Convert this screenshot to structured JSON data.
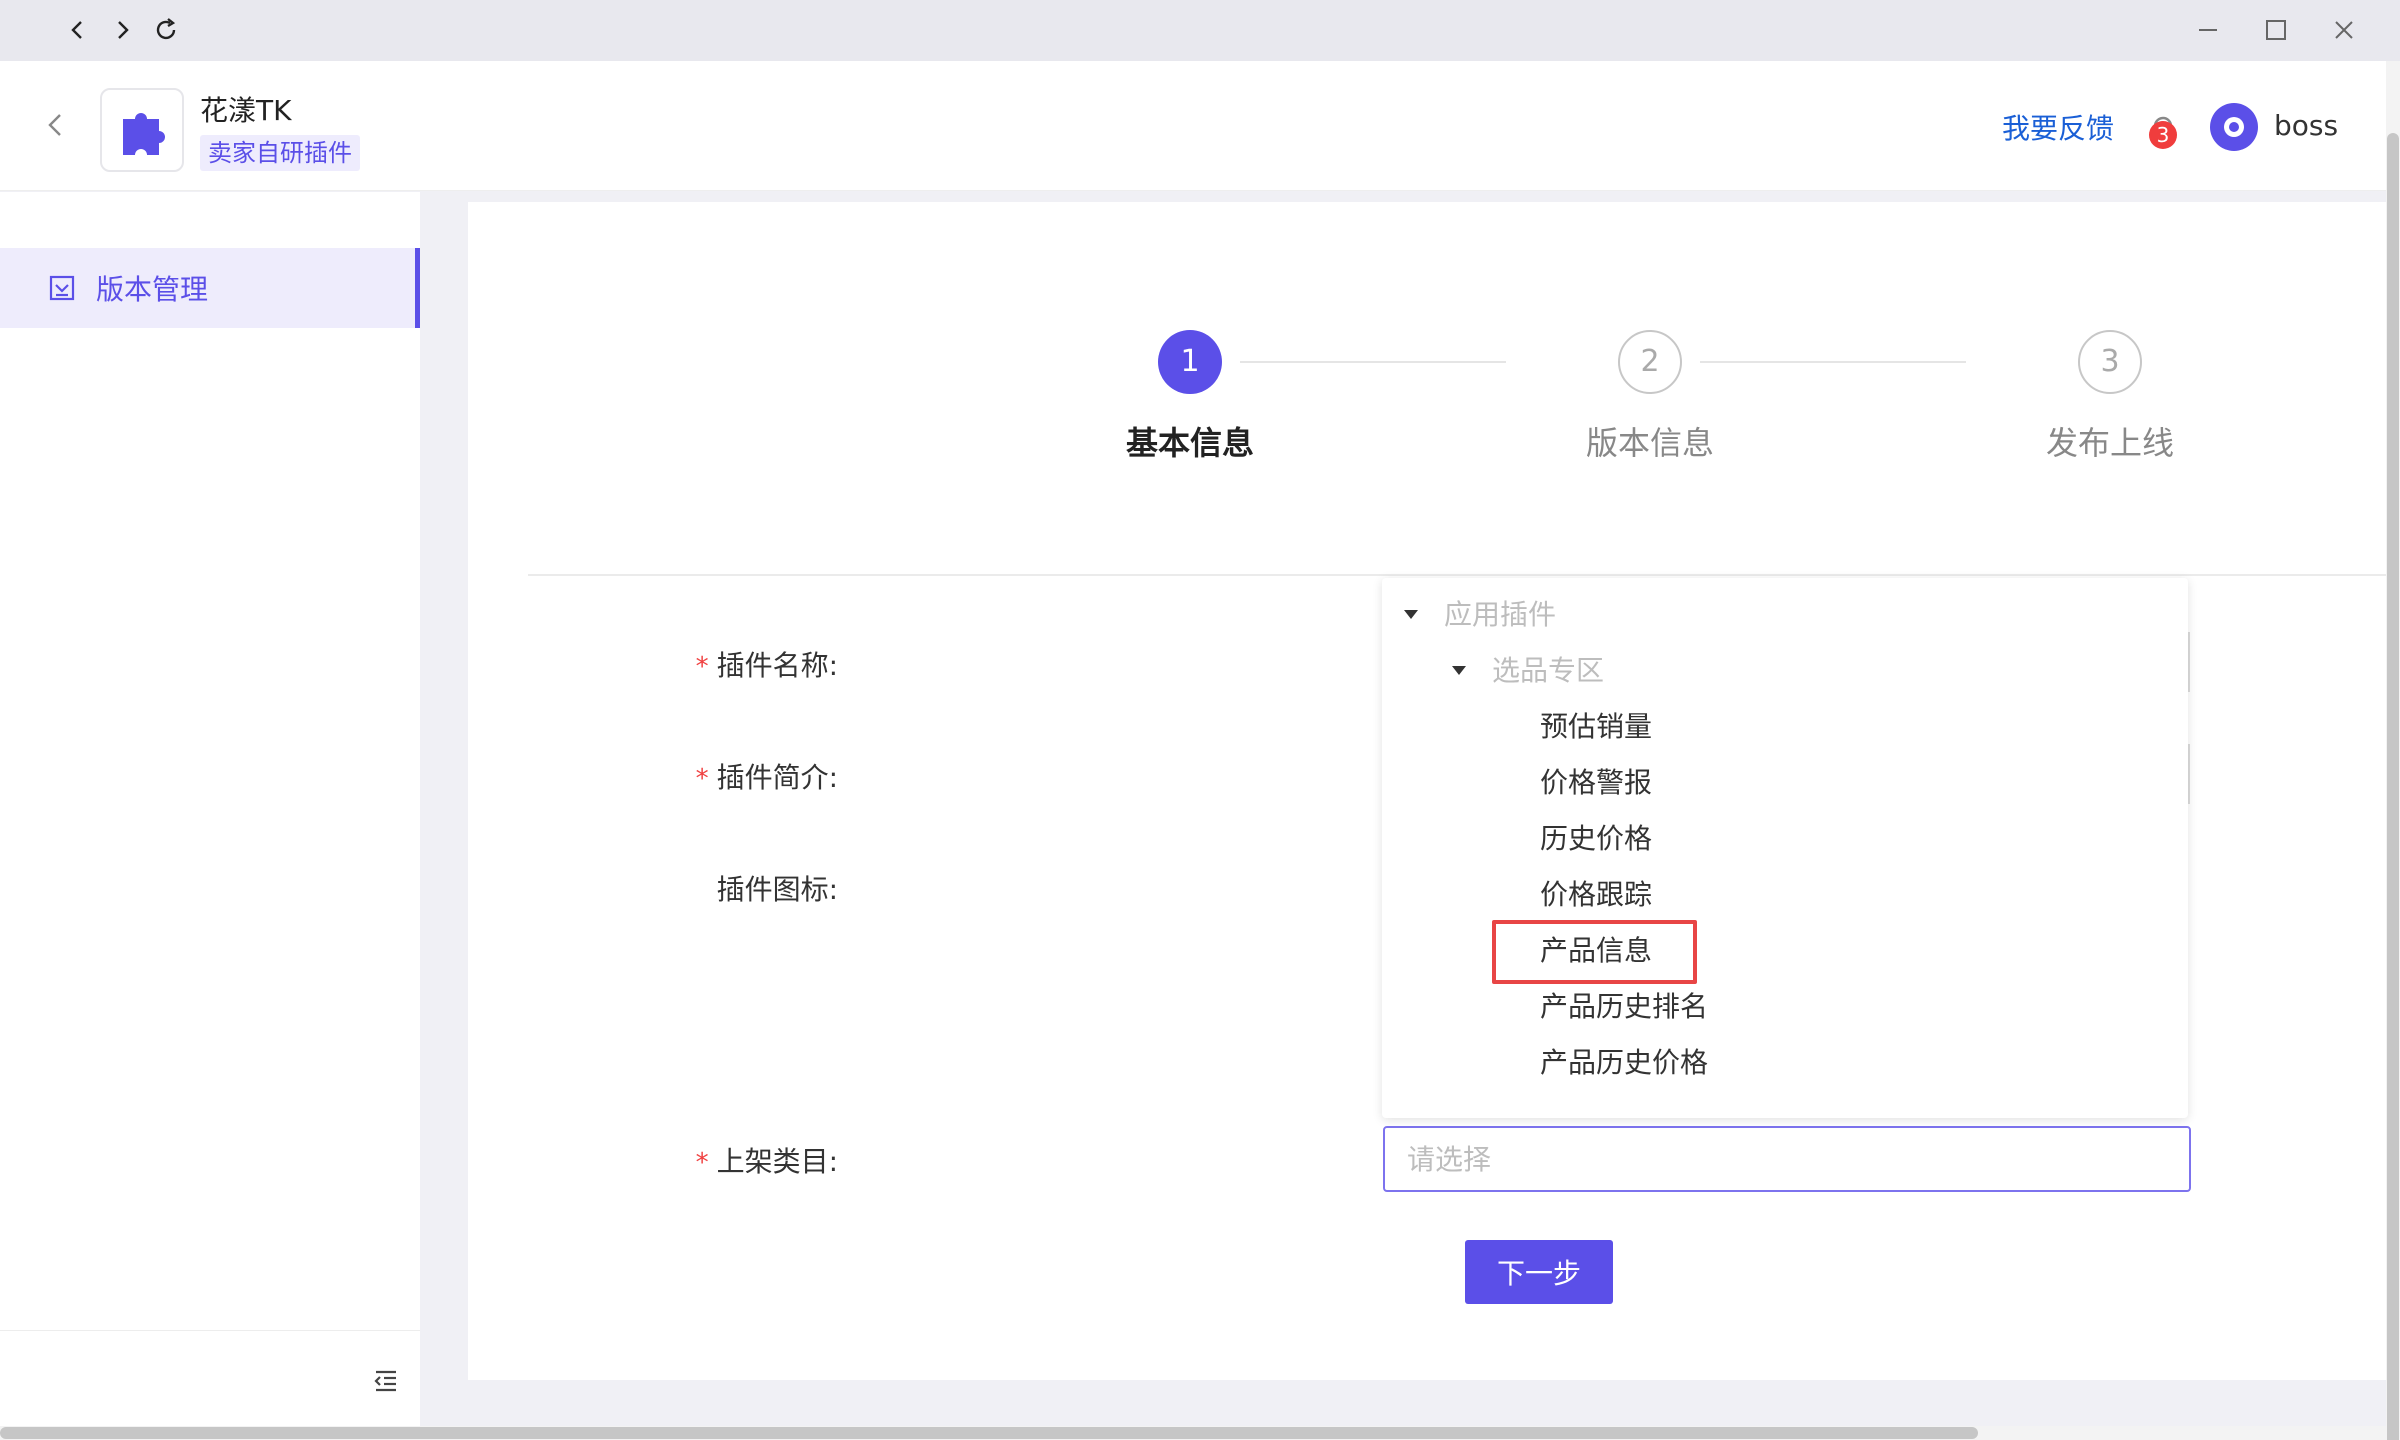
{
  "app": {
    "name": "花漾TK",
    "tag": "卖家自研插件",
    "feedback_label": "我要反馈",
    "notification_count": "3",
    "username": "boss",
    "accent_color": "#5b4fe8"
  },
  "sidebar": {
    "items": [
      {
        "label": "版本管理",
        "icon": "version-icon",
        "active": true
      }
    ]
  },
  "steps": [
    {
      "number": "1",
      "label": "基本信息",
      "state": "active"
    },
    {
      "number": "2",
      "label": "版本信息",
      "state": "todo"
    },
    {
      "number": "3",
      "label": "发布上线",
      "state": "todo"
    }
  ],
  "form": {
    "plugin_name_label": "插件名称:",
    "plugin_desc_label": "插件简介:",
    "plugin_icon_label": "插件图标:",
    "category_label": "上架类目:",
    "category_placeholder": "请选择",
    "next_button": "下一步"
  },
  "dropdown": {
    "root": "应用插件",
    "group": "选品专区",
    "leaves": [
      "预估销量",
      "价格警报",
      "历史价格",
      "价格跟踪",
      "产品信息",
      "产品历史排名",
      "产品历史价格"
    ],
    "highlighted_leaf": "产品信息"
  }
}
